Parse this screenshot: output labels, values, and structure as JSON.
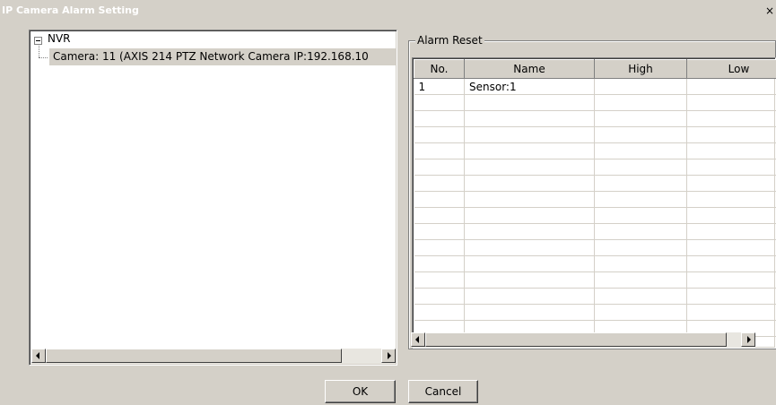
{
  "window": {
    "title": "IP Camera Alarm Setting",
    "close_glyph": "×"
  },
  "tree": {
    "root_label": "NVR",
    "expander_glyph": "minus-box",
    "child_label": "Camera: 11 (AXIS 214 PTZ Network Camera IP:192.168.10"
  },
  "group": {
    "title": "Alarm Reset"
  },
  "table": {
    "columns": [
      "No.",
      "Name",
      "High",
      "Low"
    ],
    "rows": [
      [
        "1",
        "Sensor:1",
        "",
        ""
      ]
    ]
  },
  "buttons": {
    "ok": "OK",
    "cancel": "Cancel"
  },
  "colors": {
    "face": "#d4d0c8",
    "selection": "#d4d0c8",
    "window": "#ffffff"
  }
}
